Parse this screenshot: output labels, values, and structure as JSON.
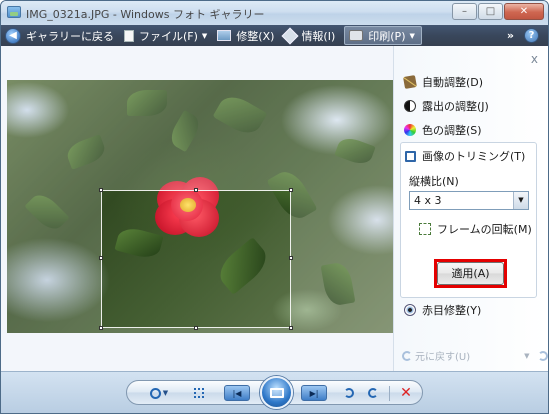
{
  "window": {
    "title": "IMG_0321a.JPG - Windows フォト ギャラリー",
    "caption_buttons": [
      "minimize-icon",
      "maximize-icon",
      "close-icon"
    ]
  },
  "toolbar": {
    "back_label": "ギャラリーに戻る",
    "file_label": "ファイル(F)",
    "fix_label": "修整(X)",
    "info_label": "情報(I)",
    "print_label": "印刷(P)",
    "more_label": "»",
    "help_label": "?"
  },
  "pane": {
    "close_label": "x",
    "auto_adjust": "自動調整(D)",
    "exposure": "露出の調整(J)",
    "color": "色の調整(S)",
    "crop": {
      "title": "画像のトリミング(T)",
      "ratio_label": "縦横比(N)",
      "ratio_value": "4 x 3",
      "rotate_label": "フレームの回転(M)",
      "apply_label": "適用(A)"
    },
    "red_eye": "赤目修整(Y)",
    "undo_label": "元に戻す(U)"
  },
  "colors": {
    "toolbar_bg": "#0e1f38",
    "highlight": "#e40000",
    "accent": "#2467b3"
  },
  "icons": {
    "back": "back-arrow-icon",
    "file": "file-icon",
    "fix": "fix-icon",
    "info": "info-icon",
    "print": "printer-icon",
    "help": "help-icon",
    "auto_adjust": "magic-wand-icon",
    "exposure": "exposure-icon",
    "color": "color-wheel-icon",
    "crop": "crop-icon",
    "rotate_frame": "rotate-frame-icon",
    "red_eye": "eye-icon",
    "undo": "undo-icon",
    "redo": "redo-icon",
    "zoom": "zoom-icon",
    "actual_size": "actual-size-icon",
    "previous": "previous-icon",
    "slideshow": "slideshow-icon",
    "next": "next-icon",
    "rotate_ccw": "rotate-counterclockwise-icon",
    "rotate_cw": "rotate-clockwise-icon",
    "delete": "delete-icon"
  }
}
